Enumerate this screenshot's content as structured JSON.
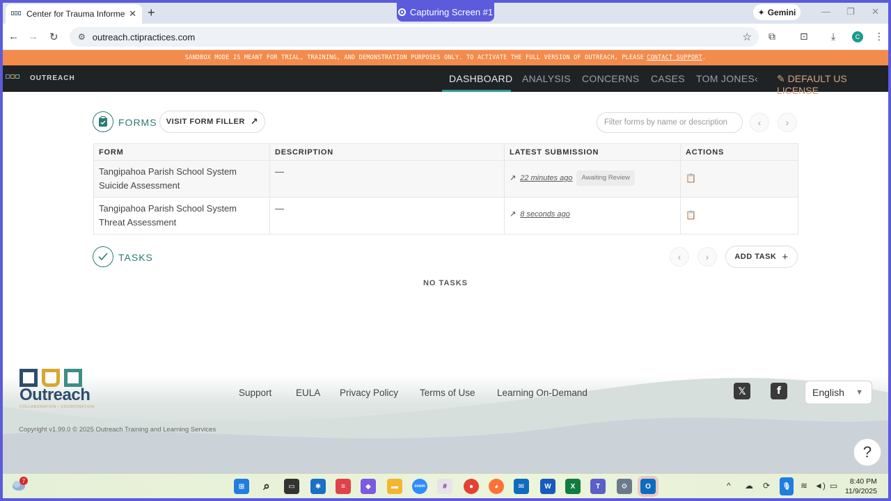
{
  "browser": {
    "tab_title": "Center for Trauma Informed Pra",
    "capture_label": "Capturing Screen #1",
    "gemini_label": "Gemini",
    "url": "outreach.ctipractices.com",
    "profile_initial": "C"
  },
  "sandbox": {
    "message": "SANDBOX MODE IS MEANT FOR TRIAL, TRAINING, AND DEMONSTRATION PURPOSES ONLY. TO ACTIVATE THE FULL VERSION OF OUTREACH, PLEASE",
    "link": "CONTACT SUPPORT",
    "end": "."
  },
  "header": {
    "brand": "OUTREACH",
    "nav": [
      "DASHBOARD",
      "ANALYSIS",
      "CONCERNS",
      "CASES",
      "TOM JONES"
    ],
    "active": "DASHBOARD",
    "license": "DEFAULT US LICENSE"
  },
  "forms": {
    "title": "FORMS",
    "visit_button": "VISIT FORM FILLER",
    "filter_placeholder": "Filter forms by name or description",
    "columns": [
      "FORM",
      "DESCRIPTION",
      "LATEST SUBMISSION",
      "ACTIONS"
    ],
    "rows": [
      {
        "form_line1": "Tangipahoa Parish School System",
        "form_line2": "Suicide Assessment",
        "description": "—",
        "latest": "22 minutes ago",
        "status": "Awaiting Review"
      },
      {
        "form_line1": "Tangipahoa Parish School System",
        "form_line2": "Threat Assessment",
        "description": "—",
        "latest": "8 seconds ago",
        "status": ""
      }
    ]
  },
  "tasks": {
    "title": "TASKS",
    "add_button": "ADD TASK",
    "empty": "NO TASKS"
  },
  "footer": {
    "logo_name": "Outreach",
    "logo_tagline": "COLLABORATION • COORDINATION",
    "links": [
      "Support",
      "EULA",
      "Privacy Policy",
      "Terms of Use",
      "Learning On-Demand"
    ],
    "language": "English",
    "copyright": "Copyright v1.99.0 © 2025 Outreach Training and Learning Services",
    "help": "?"
  },
  "taskbar": {
    "notification_count": "7",
    "time": "8:40 PM",
    "date": "11/9/2025"
  },
  "colors": {
    "accent": "#2a7b75",
    "sandbox": "#f28b4b",
    "header_bg": "#1f2325",
    "license": "#d7a380"
  }
}
